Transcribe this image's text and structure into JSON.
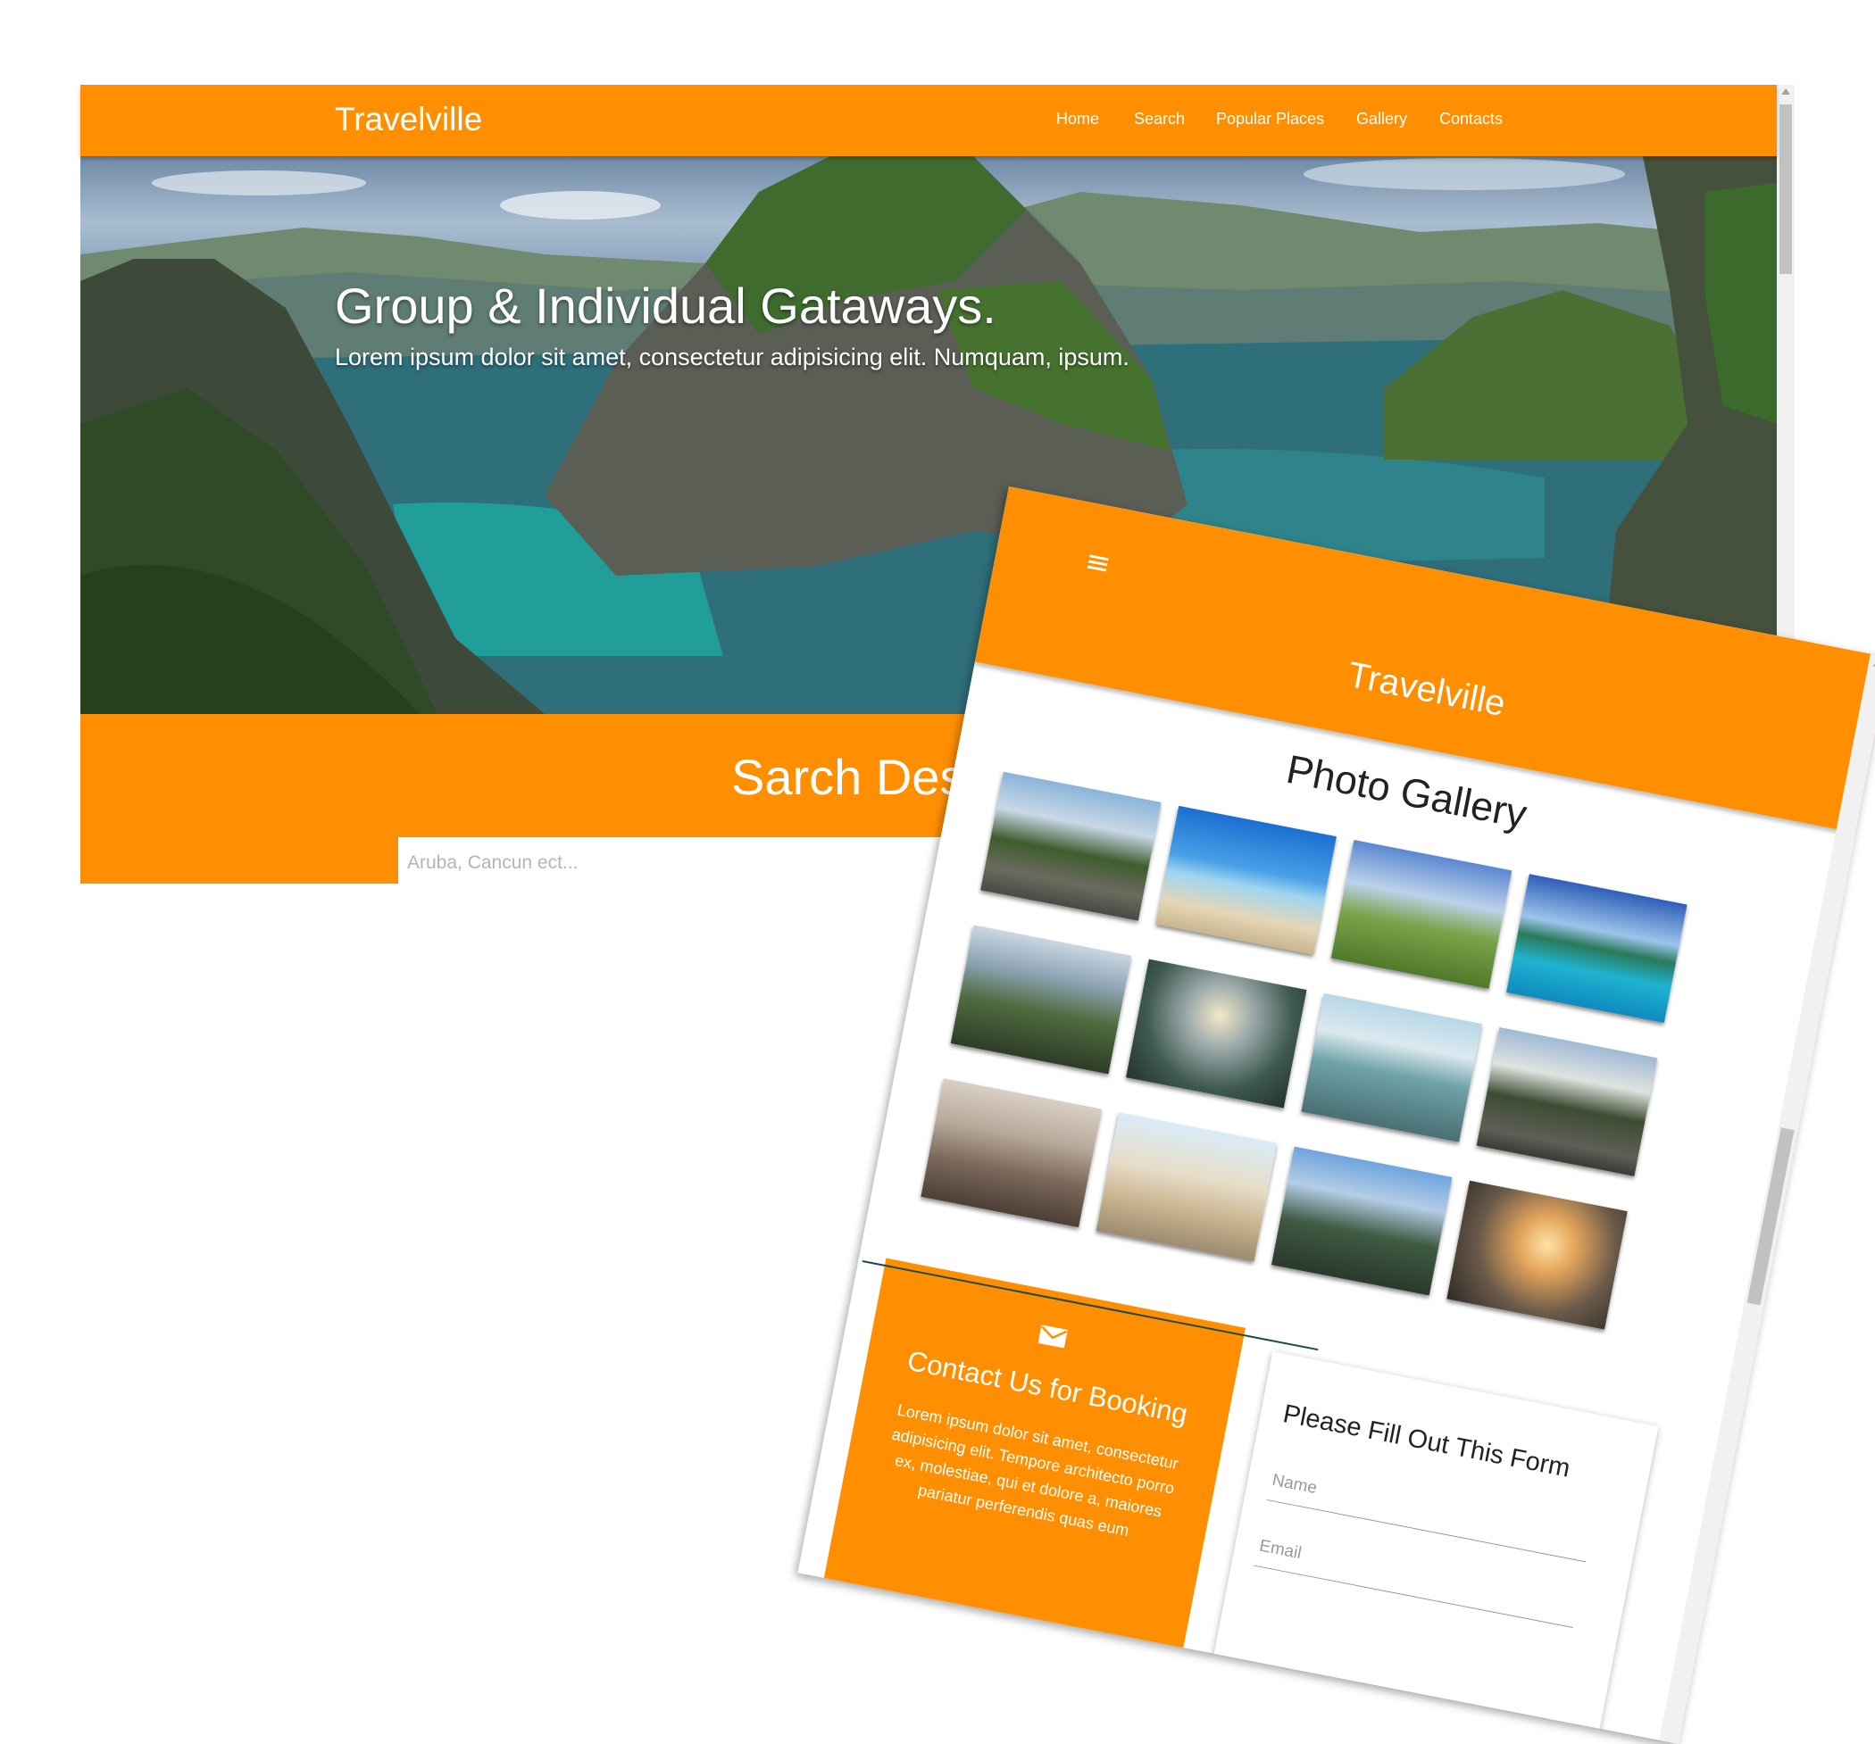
{
  "desktop": {
    "logo": "Travelville",
    "nav": [
      "Home",
      "Search",
      "Popular Places",
      "Gallery",
      "Contacts"
    ],
    "hero_title": "Group & Individual Gataways.",
    "hero_subtitle": "Lorem ipsum dolor sit amet, consectetur adipisicing elit. Numquam, ipsum.",
    "search_title": "Sarch Destination",
    "search_placeholder": "Aruba, Cancun ect..."
  },
  "mobile": {
    "menu_icon": "hamburger-icon",
    "logo": "Travelville",
    "gallery_title": "Photo Gallery",
    "photos": [
      "palm-road",
      "beach-woman",
      "mountain-hiker",
      "overwater-bungalows",
      "couple-mountains",
      "cloudy-valley",
      "river-meditation",
      "palm-road-2",
      "balloons-city",
      "ruins-traveler",
      "temple-gate",
      "tent-sunset"
    ],
    "contact_icon": "envelope-icon",
    "contact_title": "Contact Us for Booking",
    "contact_text": "Lorem ipsum dolor sit amet, consectetur adipisicing elit. Tempore architecto porro ex, molestiae, qui et dolore a, maiores pariatur perferendis quas eum",
    "form_title": "Please Fill Out This Form",
    "name_placeholder": "Name",
    "email_placeholder": "Email"
  },
  "colors": {
    "accent": "#ff8f00",
    "text_light": "#ffffff"
  }
}
